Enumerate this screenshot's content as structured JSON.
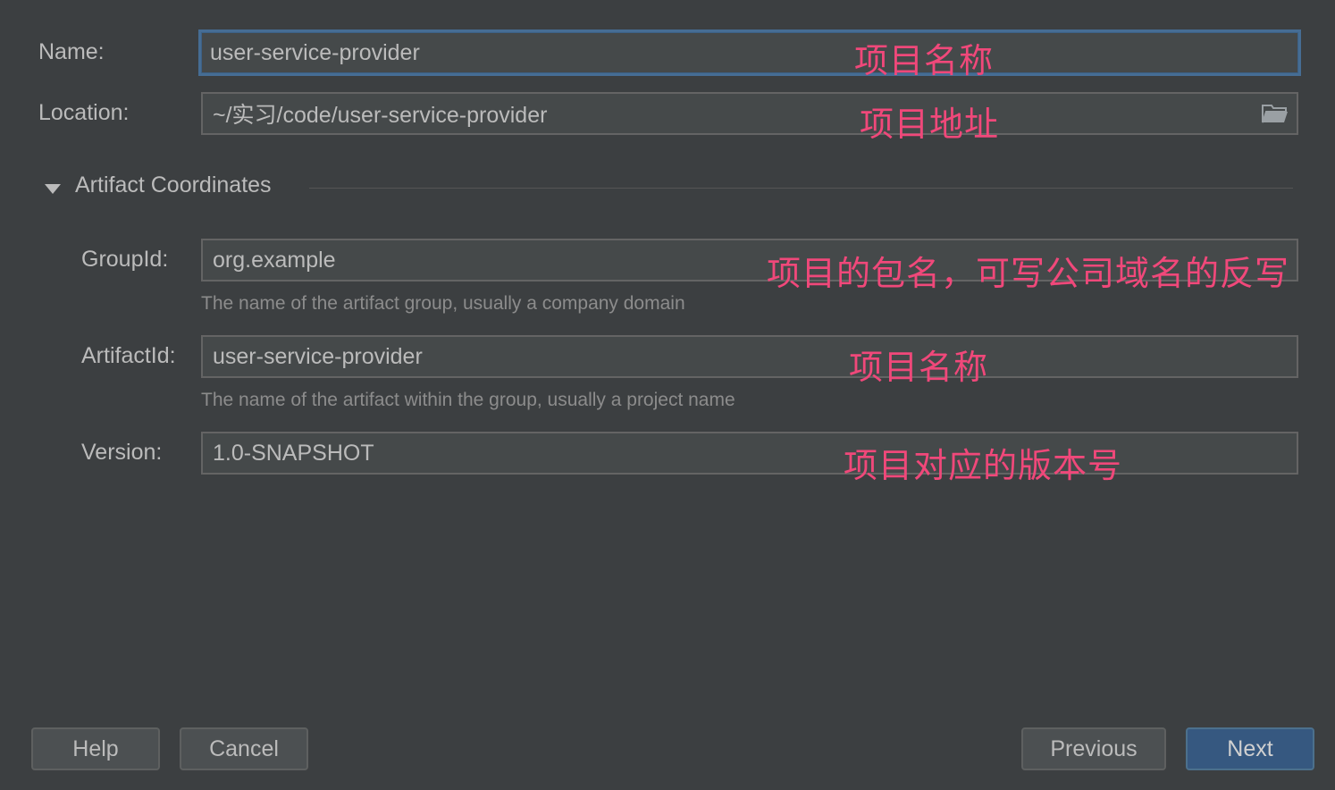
{
  "form": {
    "name_label": "Name:",
    "name_value": "user-service-provider",
    "location_label": "Location:",
    "location_value": "~/实习/code/user-service-provider",
    "section_title": "Artifact Coordinates",
    "groupid_label": "GroupId:",
    "groupid_value": "org.example",
    "groupid_hint": "The name of the artifact group, usually a company domain",
    "artifactid_label": "ArtifactId:",
    "artifactid_value": "user-service-provider",
    "artifactid_hint": "The name of the artifact within the group, usually a project name",
    "version_label": "Version:",
    "version_value": "1.0-SNAPSHOT"
  },
  "annotations": {
    "name": "项目名称",
    "location": "项目地址",
    "groupid": "项目的包名，可写公司域名的反写",
    "artifactid": "项目名称",
    "version": "项目对应的版本号"
  },
  "buttons": {
    "help": "Help",
    "cancel": "Cancel",
    "previous": "Previous",
    "next": "Next"
  },
  "icons": {
    "location_browse": "folder-icon",
    "section_toggle": "triangle-down-icon"
  },
  "colors": {
    "background": "#3c3f41",
    "annotation": "#f0487a",
    "focus_border": "#466d94",
    "primary_button": "#365880"
  }
}
